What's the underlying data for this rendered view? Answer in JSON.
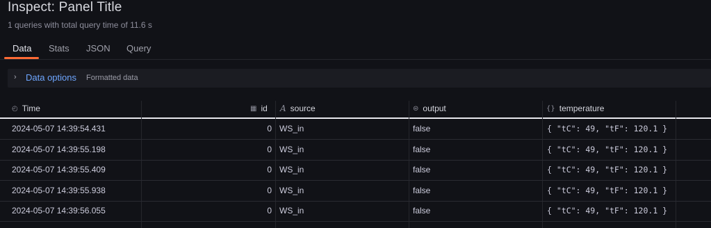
{
  "header": {
    "title": "Inspect: Panel Title",
    "subtitle": "1 queries with total query time of 11.6 s"
  },
  "tabs": [
    {
      "label": "Data",
      "active": true
    },
    {
      "label": "Stats",
      "active": false
    },
    {
      "label": "JSON",
      "active": false
    },
    {
      "label": "Query",
      "active": false
    }
  ],
  "data_options": {
    "title": "Data options",
    "description": "Formatted data"
  },
  "table": {
    "columns": [
      {
        "label": "Time",
        "icon": "clock-icon"
      },
      {
        "label": "id",
        "icon": "number-icon"
      },
      {
        "label": "source",
        "icon": "string-icon"
      },
      {
        "label": "output",
        "icon": "toggle-icon"
      },
      {
        "label": "temperature",
        "icon": "braces-icon"
      }
    ],
    "rows": [
      {
        "time": "2024-05-07 14:39:54.431",
        "id": "0",
        "source": "WS_in",
        "output": "false",
        "temperature": "{ \"tC\": 49, \"tF\": 120.1 }"
      },
      {
        "time": "2024-05-07 14:39:55.198",
        "id": "0",
        "source": "WS_in",
        "output": "false",
        "temperature": "{ \"tC\": 49, \"tF\": 120.1 }"
      },
      {
        "time": "2024-05-07 14:39:55.409",
        "id": "0",
        "source": "WS_in",
        "output": "false",
        "temperature": "{ \"tC\": 49, \"tF\": 120.1 }"
      },
      {
        "time": "2024-05-07 14:39:55.938",
        "id": "0",
        "source": "WS_in",
        "output": "false",
        "temperature": "{ \"tC\": 49, \"tF\": 120.1 }"
      },
      {
        "time": "2024-05-07 14:39:56.055",
        "id": "0",
        "source": "WS_in",
        "output": "false",
        "temperature": "{ \"tC\": 49, \"tF\": 120.1 }"
      }
    ]
  },
  "colors": {
    "accent": "#ff6b35",
    "link": "#6ea6ff",
    "background": "#111217"
  }
}
